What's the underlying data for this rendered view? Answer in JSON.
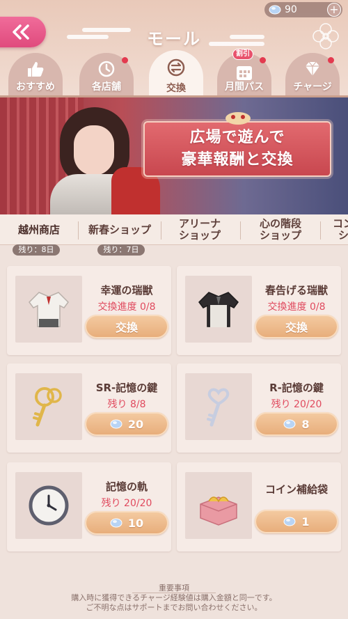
{
  "header": {
    "title": "モール",
    "currency_value": "90",
    "currency_add": "+"
  },
  "nav_tabs": [
    {
      "label": "おすすめ",
      "icon": "thumbs-up-icon",
      "active": false,
      "dot": false
    },
    {
      "label": "各店舗",
      "icon": "store-clock-icon",
      "active": false,
      "dot": true
    },
    {
      "label": "交換",
      "icon": "exchange-icon",
      "active": true,
      "dot": false
    },
    {
      "label": "月間パス",
      "icon": "calendar-icon",
      "active": false,
      "dot": true,
      "badge": "割引"
    },
    {
      "label": "チャージ",
      "icon": "diamond-icon",
      "active": false,
      "dot": true
    }
  ],
  "banner": {
    "line1": "広場で遊んで",
    "line2": "豪華報酬と交換"
  },
  "shop_tabs": [
    {
      "label": "越州商店",
      "remain": "残り：8日",
      "active": true
    },
    {
      "label": "新春ショップ",
      "remain": "残り：7日",
      "active": false
    },
    {
      "label": "アリーナショップ",
      "line1": "アリーナ",
      "line2": "ショップ"
    },
    {
      "label": "心の階段ショップ",
      "line1": "心の階段",
      "line2": "ショップ"
    },
    {
      "label": "コン…",
      "line1": "コン",
      "line2": "シ"
    }
  ],
  "items": [
    {
      "name": "幸運の瑞獣",
      "sub": "交換進度 0/8",
      "button": "交換",
      "icon": "white-coat-icon"
    },
    {
      "name": "春告げる瑞獣",
      "sub": "交換進度 0/8",
      "button": "交換",
      "icon": "dark-coat-icon"
    },
    {
      "name": "SR-記憶の鍵",
      "sub": "残り 8/8",
      "button": "20",
      "icon": "gold-key-icon"
    },
    {
      "name": "R-記憶の鍵",
      "sub": "残り 20/20",
      "button": "8",
      "icon": "silver-key-icon"
    },
    {
      "name": "記憶の軌",
      "sub": "残り 20/20",
      "button": "10",
      "icon": "clock-icon"
    },
    {
      "name": "コイン補給袋",
      "sub": "",
      "button": "1",
      "icon": "coin-box-icon"
    }
  ],
  "notice": {
    "title": "重要事項",
    "line1": "購入時に獲得できるチャージ経験値は購入金額と同一です。",
    "line2": "ご不明な点はサポートまでお問い合わせください。"
  },
  "colors": {
    "accent_pink": "#e04a7d",
    "red_text": "#e04a5e",
    "button_orange": "#e7ac79",
    "background": "#efe2dc"
  }
}
